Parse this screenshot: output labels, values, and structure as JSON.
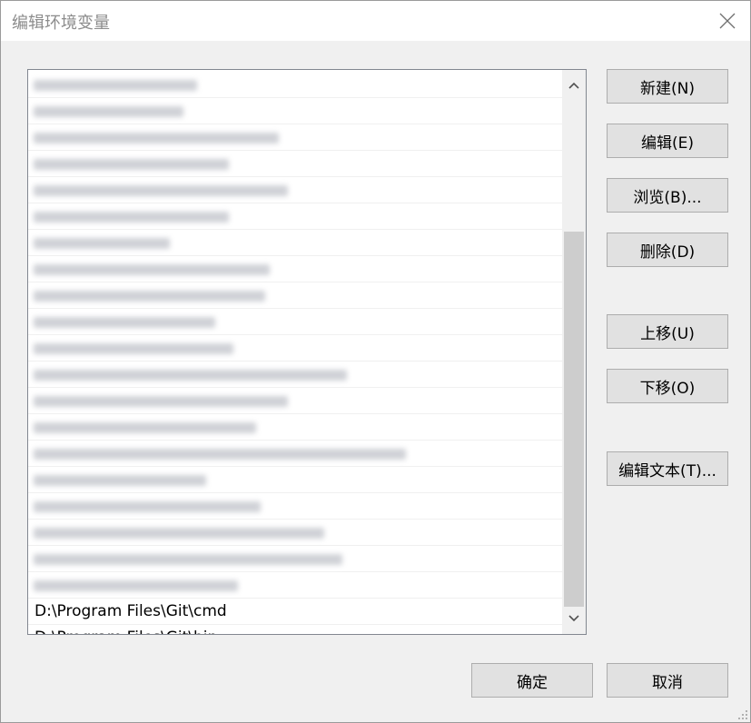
{
  "window": {
    "title": "编辑环境变量",
    "close_icon": "close-icon"
  },
  "list": {
    "blurred_rows": [
      {
        "w": 180
      },
      {
        "w": 165
      },
      {
        "w": 270
      },
      {
        "w": 215
      },
      {
        "w": 280
      },
      {
        "w": 215
      },
      {
        "w": 150
      },
      {
        "w": 260
      },
      {
        "w": 255
      },
      {
        "w": 200
      },
      {
        "w": 220
      },
      {
        "w": 345
      },
      {
        "w": 280
      },
      {
        "w": 245
      },
      {
        "w": 410
      },
      {
        "w": 190
      },
      {
        "w": 250
      },
      {
        "w": 320
      },
      {
        "w": 340
      },
      {
        "w": 225
      }
    ],
    "visible_paths": [
      "D:\\Program Files\\Git\\cmd",
      "D:\\Program Files\\Git\\bin"
    ]
  },
  "buttons": {
    "new": "新建(N)",
    "edit": "编辑(E)",
    "browse": "浏览(B)...",
    "delete": "删除(D)",
    "move_up": "上移(U)",
    "move_down": "下移(O)",
    "edit_text": "编辑文本(T)...",
    "ok": "确定",
    "cancel": "取消"
  }
}
